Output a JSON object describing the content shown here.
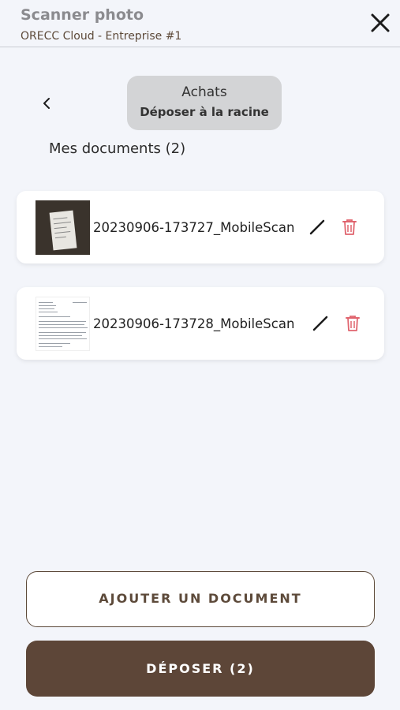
{
  "header": {
    "title": "Scanner photo",
    "subtitle": "ORECC Cloud - Entreprise #1",
    "close_icon": "close-icon"
  },
  "folder": {
    "name": "Achats",
    "action": "Déposer à la racine",
    "back_icon": "chevron-left-icon"
  },
  "section": {
    "title": "Mes documents (2)"
  },
  "documents": [
    {
      "name": "20230906-173727_MobileScan",
      "edit_icon": "pencil-icon",
      "delete_icon": "trash-icon"
    },
    {
      "name": "20230906-173728_MobileScan",
      "edit_icon": "pencil-icon",
      "delete_icon": "trash-icon"
    }
  ],
  "actions": {
    "add_label": "AJOUTER UN DOCUMENT",
    "submit_label": "DÉPOSER (2)"
  },
  "colors": {
    "brand": "#5d4638",
    "delete": "#e0646e",
    "background": "#f3f5fa"
  }
}
